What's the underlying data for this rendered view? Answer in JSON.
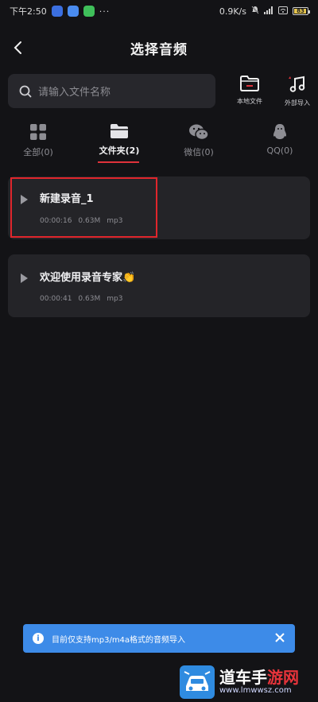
{
  "status_bar": {
    "time": "下午2:50",
    "dots": "···",
    "network_speed": "0.9K/s",
    "battery": "83"
  },
  "header": {
    "title": "选择音频"
  },
  "search": {
    "placeholder": "请输入文件名称"
  },
  "tools": [
    {
      "label": "本地文件",
      "icon": "folder-icon"
    },
    {
      "label": "外部导入",
      "icon": "music-note-icon"
    }
  ],
  "tabs": [
    {
      "label": "全部(0)",
      "icon": "grid-icon"
    },
    {
      "label": "文件夹(2)",
      "icon": "folder-icon",
      "active": true
    },
    {
      "label": "微信(0)",
      "icon": "wechat-icon"
    },
    {
      "label": "QQ(0)",
      "icon": "qq-penguin-icon"
    }
  ],
  "recordings": [
    {
      "title": "新建录音_1",
      "duration": "00:00:16",
      "size": "0.63M",
      "format": "mp3"
    },
    {
      "title": "欢迎使用录音专家👏",
      "duration": "00:00:41",
      "size": "0.63M",
      "format": "mp3"
    }
  ],
  "toast": {
    "message": "目前仅支持mp3/m4a格式的音频导入"
  },
  "watermark": {
    "brand_white": "道车手",
    "brand_red": "游网",
    "url": "www.lmwwsz.com"
  },
  "colors": {
    "background": "#131316",
    "card": "#242428",
    "accent_red": "#e0323b",
    "toast_blue": "#3d8be8"
  }
}
